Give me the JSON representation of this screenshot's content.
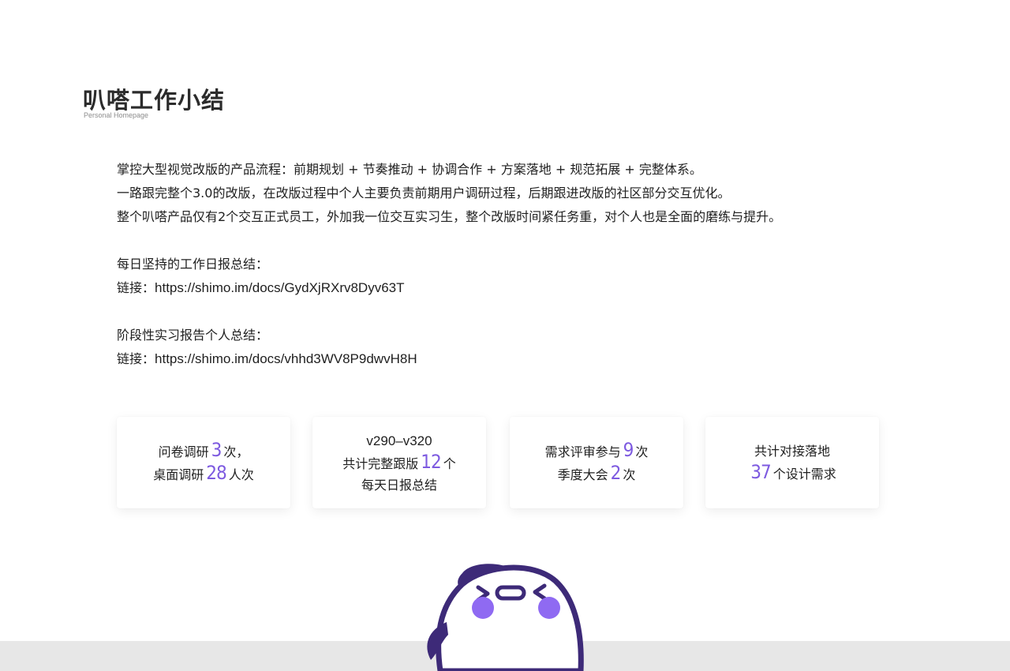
{
  "header": {
    "title": "叭嗒工作小结",
    "subtitle": "Personal Homepage"
  },
  "intro": {
    "lines": [
      "掌控大型视觉改版的产品流程：前期规划 + 节奏推动 + 协调合作 + 方案落地 + 规范拓展 + 完整体系。",
      "一路跟完整个3.0的改版，在改版过程中个人主要负责前期用户调研过程，后期跟进改版的社区部分交互优化。",
      "整个叭嗒产品仅有2个交互正式员工，外加我一位交互实习生，整个改版时间紧任务重，对个人也是全面的磨练与提升。"
    ],
    "daily_summary": {
      "label": "每日坚持的工作日报总结：",
      "link_prefix": "链接：",
      "link_url": "https://shimo.im/docs/GydXjRXrv8Dyv63T"
    },
    "intern_report": {
      "label": "阶段性实习报告个人总结：",
      "link_prefix": "链接：",
      "link_url": "https://shimo.im/docs/vhhd3WV8P9dwvH8H"
    }
  },
  "stats": {
    "accent_color": "#7d5ae0",
    "card1": {
      "r1_pre": "问卷调研",
      "r1_num": "3",
      "r1_post": "次，",
      "r2_pre": "桌面调研",
      "r2_num": "28",
      "r2_post": "人次"
    },
    "card2": {
      "r1": "v290–v320",
      "r2_pre": "共计完整跟版",
      "r2_num": "12",
      "r2_post": "个",
      "r3": "每天日报总结"
    },
    "card3": {
      "r1_pre": "需求评审参与",
      "r1_num": "9",
      "r1_post": "次",
      "r2_pre": "季度大会",
      "r2_num": "2",
      "r2_post": "次"
    },
    "card4": {
      "r1": "共计对接落地",
      "r2_num": "37",
      "r2_post": "个设计需求"
    }
  },
  "mascot": {
    "icon": "penguin-mascot-icon",
    "colors": {
      "outline": "#3d2a78",
      "cheeks": "#8f6af2",
      "body": "#ffffff"
    }
  },
  "footer": {
    "band_color": "#e7e7e7"
  }
}
